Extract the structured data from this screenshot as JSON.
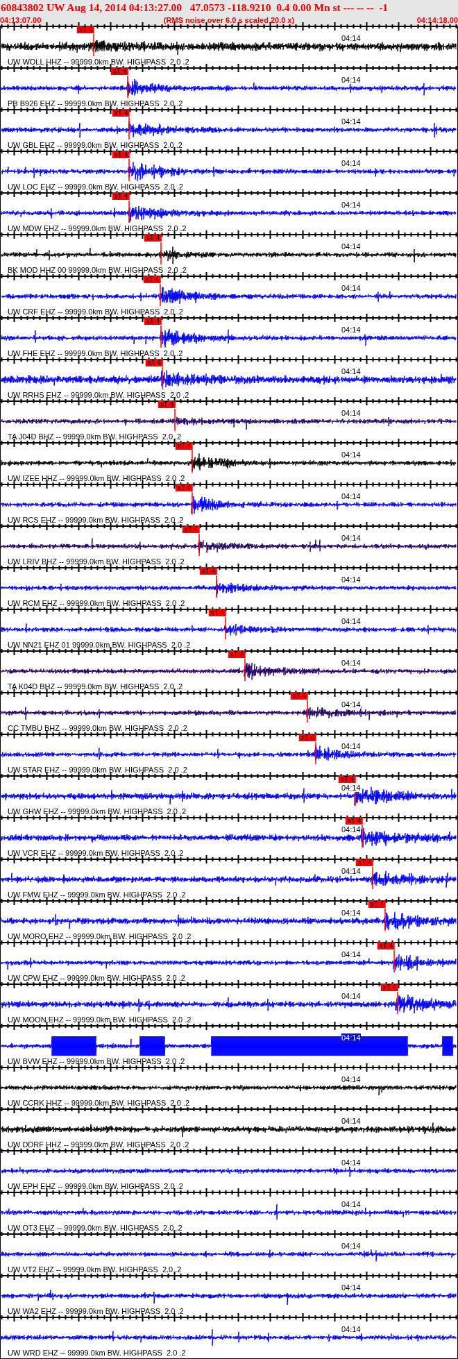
{
  "header": {
    "title": "60843802 UW Aug 14, 2014 04:13:27.00   47.0573 -118.9210  0.4 0.00 Mn st --- -- --  -1",
    "start_time": "04:13:07.00",
    "note": "(RMS noise over 6.0 s scaled 20.0 x)",
    "end_time": "04:14:18.00"
  },
  "traces": [
    {
      "label": "UW WOLL HHZ -- 99999.0km BW. HIGHPASS  2.0 .2",
      "time_label": "04:14",
      "color": "#000000",
      "pick": {
        "label": "xT 4",
        "level": 0.205
      }
    },
    {
      "label": "PB B926 EHZ -- 99999.0km BW. HIGHPASS  2.0 .2",
      "time_label": "04:14",
      "color": "#0000ff",
      "pick": {
        "label": "xT 4",
        "level": 0.279
      }
    },
    {
      "label": "UW GBL EHZ -- 99999.0km BW. HIGHPASS  2.0 .2",
      "time_label": "04:14",
      "color": "#0000ff",
      "pick": {
        "label": "xT 4",
        "level": 0.282
      }
    },
    {
      "label": "UW LOC EHZ -- 99999.0km BW. HIGHPASS  2.0 .2",
      "time_label": "04:14",
      "color": "#0000ff",
      "pick": {
        "label": "xT 4",
        "level": 0.282
      }
    },
    {
      "label": "UW MDW EHZ -- 99999.0km BW. HIGHPASS  2.0 .2",
      "time_label": "04:14",
      "color": "#0000ff",
      "pick": {
        "label": "xT 4",
        "level": 0.282
      }
    },
    {
      "label": "BK MOD HHZ 00 99999.0km BW. HIGHPASS  2.0 .2",
      "time_label": "04:14",
      "color": "#000000",
      "pick": {
        "label": "xT 4",
        "level": 0.352
      }
    },
    {
      "label": "UW CRF EHZ -- 99999.0km BW. HIGHPASS  2.0 .2",
      "time_label": "04:14",
      "color": "#0000ff",
      "pick": {
        "label": "xT 4",
        "level": 0.35
      }
    },
    {
      "label": "UW FHE EHZ -- 99999.0km BW. HIGHPASS  2.0 .2",
      "time_label": "04:14",
      "color": "#0000ff",
      "pick": {
        "label": "xT 4",
        "level": 0.352
      }
    },
    {
      "label": "UW RRHS EHZ -- 99999.0km BW. HIGHPASS  2.0 .2",
      "time_label": "04:14",
      "color": "#0000ff",
      "pick": {
        "label": "xT 4",
        "level": 0.355
      }
    },
    {
      "label": "TA J04D BHZ -- 99999.0km BW. HIGHPASS  2.0 .2",
      "time_label": "04:14",
      "color": "#220066",
      "pick": {
        "label": "xT 4",
        "level": 0.382
      }
    },
    {
      "label": "UW IZEE HHZ -- 99999.0km BW. HIGHPASS  2.0 .2",
      "time_label": "04:14",
      "color": "#000000",
      "pick": {
        "label": "xT 4",
        "level": 0.42
      }
    },
    {
      "label": "UW RCS EHZ -- 99999.0km BW. HIGHPASS  2.0 .2",
      "time_label": "04:14",
      "color": "#0000ff",
      "pick": {
        "label": "xT 4",
        "level": 0.42
      }
    },
    {
      "label": "UW LRIV BHZ -- 99999.0km BW. HIGHPASS  2.0 .2",
      "time_label": "04:14",
      "color": "#220066",
      "pick": {
        "label": "xT 4",
        "level": 0.435
      }
    },
    {
      "label": "UW RCM EHZ -- 99999.0km BW. HIGHPASS  2.0 .2",
      "time_label": "04:14",
      "color": "#0000ff",
      "pick": {
        "label": "xT 4",
        "level": 0.473
      }
    },
    {
      "label": "UW NN21 EHZ 01 99999.0km BW. HIGHPASS  2.0 .2",
      "time_label": "04:14",
      "color": "#0000ff",
      "pick": {
        "label": "xT 4",
        "level": 0.492
      }
    },
    {
      "label": "TA K04D BHZ -- 99999.0km BW. HIGHPASS  2.0 .2",
      "time_label": "04:14",
      "color": "#220066",
      "pick": {
        "label": "xT 4",
        "level": 0.535
      }
    },
    {
      "label": "CC TMBU BHZ -- 99999.0km BW. HIGHPASS  2.0 .2",
      "time_label": "04:14",
      "color": "#220066",
      "pick": {
        "label": "xT 4",
        "level": 0.671
      }
    },
    {
      "label": "UW STAR EHZ -- 99999.0km BW. HIGHPASS  2.0 .2",
      "time_label": "04:14",
      "color": "#0000ff",
      "pick": {
        "label": "xT 4",
        "level": 0.689
      }
    },
    {
      "label": "UW GHW EHZ -- 99999.0km BW. HIGHPASS  2.0 .2",
      "time_label": "04:14",
      "color": "#0000ff",
      "pick": {
        "label": "xT 4",
        "level": 0.776
      }
    },
    {
      "label": "UW VCR EHZ -- 99999.0km BW. HIGHPASS  2.0 .2",
      "time_label": "04:14",
      "color": "#0000ff",
      "pick": {
        "label": "xT 4",
        "level": 0.791
      }
    },
    {
      "label": "UW FMW EHZ -- 99999.0km BW. HIGHPASS  2.0 .2",
      "time_label": "04:14",
      "color": "#0000ff",
      "pick": {
        "label": "xT 4",
        "level": 0.814
      }
    },
    {
      "label": "UW MORO EHZ -- 99999.0km BW. HIGHPASS  2.0 .2",
      "time_label": "04:14",
      "color": "#0000ff",
      "pick": {
        "label": "xT 4",
        "level": 0.841
      }
    },
    {
      "label": "UW CPW EHZ -- 99999.0km BW. HIGHPASS  2.0 .2",
      "time_label": "04:14",
      "color": "#0000ff",
      "pick": {
        "label": "xT 4",
        "level": 0.861
      }
    },
    {
      "label": "UW MOON EHZ -- 99999.0km BW. HIGHPASS  2.0 .2",
      "time_label": "04:14",
      "color": "#0000ff",
      "pick": {
        "label": "xT 4",
        "level": 0.868
      }
    },
    {
      "label": "UW BVW EHZ -- 99999.0km BW. HIGHPASS  2.0 .2",
      "time_label": "04:14",
      "color": "#0000ff"
    },
    {
      "label": "UW CCRK HHZ -- 99999.0km BW. HIGHPASS  2.0 .2",
      "time_label": "04:14",
      "color": "#000000"
    },
    {
      "label": "UW DDRF HHZ -- 99999.0km BW. HIGHPASS  2.0 .2",
      "time_label": "04:14",
      "color": "#000000"
    },
    {
      "label": "UW EPH EHZ -- 99999.0km BW. HIGHPASS  2.0 .2",
      "time_label": "04:14",
      "color": "#0000ff"
    },
    {
      "label": "UW OT3 EHZ -- 99999.0km BW. HIGHPASS  2.0 .2",
      "time_label": "04:14",
      "color": "#0000ff"
    },
    {
      "label": "UW VT2 EHZ -- 99999.0km BW. HIGHPASS  2.0 .2",
      "time_label": "04:14",
      "color": "#0000ff"
    },
    {
      "label": "UW WA2 EHZ -- 99999.0km BW. HIGHPASS  2.0 .2",
      "time_label": "04:14",
      "color": "#0000ff"
    },
    {
      "label": "UW WRD EHZ -- 99999.0km BW. HIGHPASS  2.0 .2",
      "time_label": "04:14",
      "color": "#0000ff"
    }
  ]
}
